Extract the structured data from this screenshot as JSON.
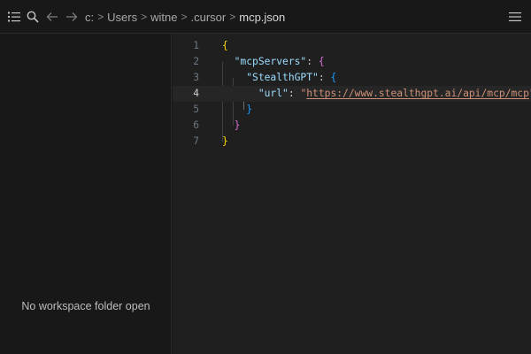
{
  "topbar": {
    "icons": [
      "outline-list-icon",
      "search-icon",
      "back-arrow-icon",
      "forward-arrow-icon",
      "more-icon"
    ],
    "breadcrumb": [
      "c:",
      "Users",
      "witne",
      ".cursor",
      "mcp.json"
    ],
    "separator": ">"
  },
  "sidebar": {
    "empty_message": "No workspace folder open"
  },
  "editor": {
    "active_line": 4,
    "lines": [
      {
        "number": "1"
      },
      {
        "number": "2"
      },
      {
        "number": "3"
      },
      {
        "number": "4"
      },
      {
        "number": "5"
      },
      {
        "number": "6"
      },
      {
        "number": "7"
      }
    ],
    "tokens": {
      "open_brace": "{",
      "close_brace": "}",
      "key_mcpServers": "\"mcpServers\"",
      "key_StealthGPT": "\"StealthGPT\"",
      "key_url": "\"url\"",
      "colon": ": ",
      "url_quote": "\"",
      "url_value": "https://www.stealthgpt.ai/api/mcp/mcp"
    },
    "colors": {
      "bracket_level1": "#ffd700",
      "bracket_level2": "#da70d6",
      "bracket_level3": "#179fff",
      "json_key": "#9cdcfe",
      "json_string": "#ce9178"
    }
  }
}
